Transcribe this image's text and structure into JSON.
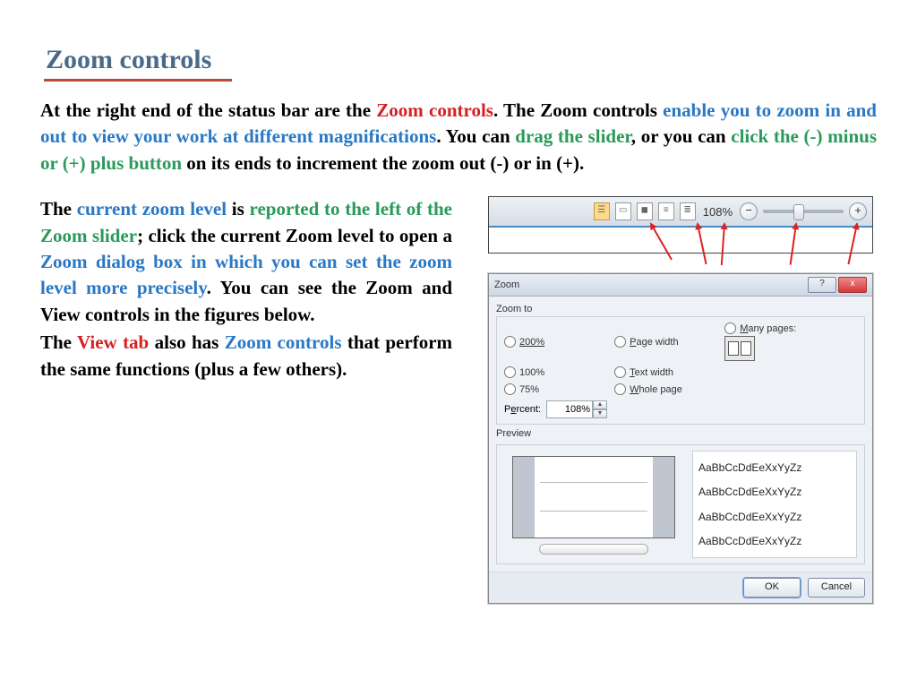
{
  "title": "Zoom controls",
  "p1": {
    "a": "At the right end of the status bar are the ",
    "zoom_controls": "Zoom controls",
    "b": ". The Zoom controls ",
    "enable": "enable you to zoom in and out to view your work at different magnifications",
    "c": ". You can ",
    "drag": "drag the slider",
    "d": ", or you can ",
    "click": "click the (-) minus or (+) plus button",
    "e": " on its ends to increment the zoom out (-) or in (+)."
  },
  "p2": {
    "a": "The ",
    "czl": "current zoom level",
    "b": " is ",
    "reported": "reported to the left of the Zoom slider",
    "c": "; click the current Zoom level to open a ",
    "dlg": "Zoom dialog box in which you can set the zoom level more precisely",
    "d": ". You can see the Zoom and View controls in the figures below."
  },
  "p3": {
    "a": "The ",
    "view": "View tab",
    "b": " also has ",
    "zc": "Zoom controls",
    "c": " that perform the same functions (plus a few others)."
  },
  "status": {
    "zoom_pct": "108%",
    "minus": "−",
    "plus": "+"
  },
  "dialog": {
    "title": "Zoom",
    "help": "?",
    "close": "x",
    "zoom_to": "Zoom to",
    "opt_200": "200%",
    "opt_100": "100%",
    "opt_75": "75%",
    "opt_pagew": "Page width",
    "opt_textw": "Text width",
    "opt_whole": "Whole page",
    "opt_many": "Many pages:",
    "percent_lbl": "Percent:",
    "percent_val": "108%",
    "preview_lbl": "Preview",
    "sample": "AaBbCcDdEeXxYyZz",
    "ok": "OK",
    "cancel": "Cancel"
  }
}
